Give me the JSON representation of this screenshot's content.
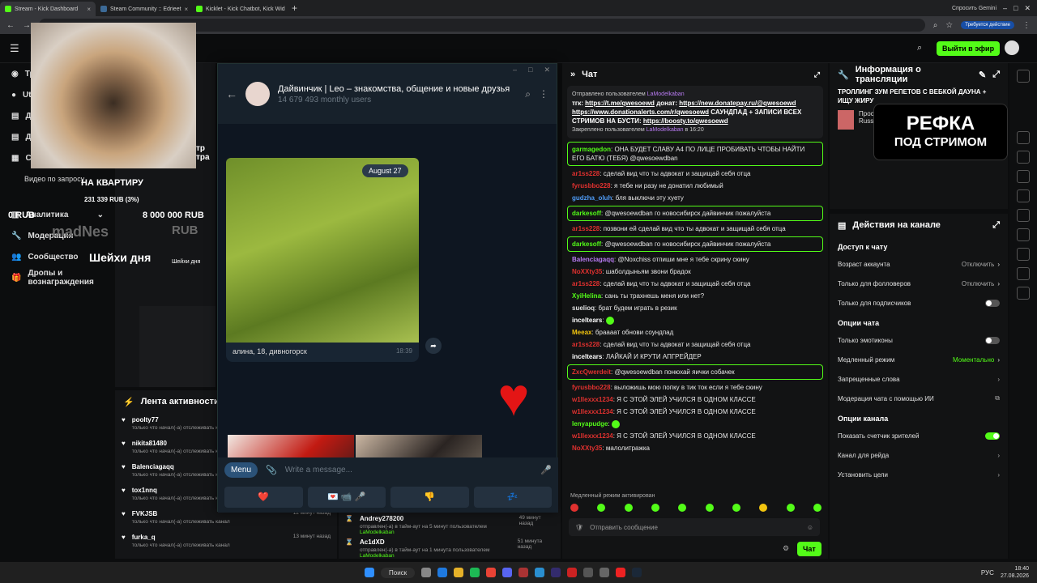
{
  "browser": {
    "tabs": [
      {
        "label": "Stream - Kick Dashboard",
        "color": "#53fc18",
        "active": true
      },
      {
        "label": "Steam Community :: Edrieet",
        "color": "#1b2838",
        "active": false
      },
      {
        "label": "Kicklet - Kick Chatbot, Kick Wid",
        "color": "#53fc18",
        "active": false
      }
    ],
    "gemini_label": "Спросить Gemini",
    "action_label": "Требуется действие"
  },
  "kick": {
    "go_live_label": "Выйти в эфир",
    "left_nav": [
      "Аналитика",
      "Модерация",
      "Сообщество",
      "Дропы и вознаграждения"
    ],
    "nav_top_fragments": [
      "Тр",
      "Ut",
      "Д",
      "Д",
      "Ст"
    ],
    "video_requests": "Видео по запросу",
    "ghost_title": "тр тра"
  },
  "overlays": {
    "apartment_title": "НА КВАРТИРУ",
    "apartment_amount": "231 339 RUB (3%)",
    "goal_left": "0 RUB",
    "goal_right": "8 000 000 RUB",
    "ghost_text": "madNes",
    "ghost_rub": "RUB",
    "neck_day": "Шейхи дня",
    "neck_day_small": "Шейхи дня",
    "refka_line1": "РЕФКА",
    "refka_line2": "ПОД СТРИМОМ"
  },
  "telegram": {
    "title": "Дайвинчик | Leo – знакомства, общение и новые друзья",
    "subtitle": "14 679 493 monthly users",
    "date_badge": "August 27",
    "caption": "алина, 18, дивногорск",
    "time": "18:39",
    "menu_label": "Menu",
    "placeholder": "Write a message...",
    "reactions": [
      "❤️",
      "💌 📹 🎤",
      "👎",
      "💤"
    ]
  },
  "chat": {
    "title": "Чат",
    "pinned_by_label": "Отправлено пользователем",
    "pinned_by_user": "LaModelkaban",
    "pinned_text_parts": [
      "тгк:",
      "https://t.me/qwesoewd",
      "донат:",
      "https://new.donatepay.ru/@qwesoewd",
      "https://www.donationalerts.com/r/qwesoewd",
      "САУНДПАД + ЗАПИСИ ВСЕХ СТРИМОВ НА БУСТИ:",
      "https://boosty.to/qwesoewd"
    ],
    "pinned_footer": "Закреплено пользователем",
    "pinned_footer_user": "LaModelkaban",
    "pinned_footer_time": "в 16:20",
    "messages": [
      {
        "user": "garmagedon",
        "color": "#53fc18",
        "text": "ОНА БУДЕТ СЛАВУ А4 ПО ЛИЦЕ ПРОБИВАТЬ ЧТОБЫ НАЙТИ ЕГО БАТЮ (ТЕБЯ) @qwesoewdban",
        "hl": true
      },
      {
        "user": "ar1ss228",
        "color": "#e0312f",
        "text": "сделай вид что ты адвокат и защищай себя отца",
        "hl": false
      },
      {
        "user": "fyrusbbo228",
        "color": "#e0312f",
        "text": "я тебе ни разу не донатил любимый",
        "hl": false
      },
      {
        "user": "gudzha_oluh",
        "color": "#4f9cf7",
        "text": "бля выключи эту хуету",
        "hl": false
      },
      {
        "user": "darkesoff",
        "color": "#53fc18",
        "text": "@qwesoewdban го новосибирск дайвинчик пожалуйста",
        "hl": true
      },
      {
        "user": "ar1ss228",
        "color": "#e0312f",
        "text": "позвони ей сделай вид что ты адвокат и защищай себя отца",
        "hl": false
      },
      {
        "user": "darkesoff",
        "color": "#53fc18",
        "text": "@qwesoewdban го новосибирск дайвинчик пожалуйста",
        "hl": true
      },
      {
        "user": "Balenciagaqq",
        "color": "#b87bf2",
        "text": "@Noxchiss отпиши мне я тебе скрину скину",
        "hl": false
      },
      {
        "user": "NoXXty35",
        "color": "#e0312f",
        "text": "шаболдыньям звони брадок",
        "hl": false
      },
      {
        "user": "ar1ss228",
        "color": "#e0312f",
        "text": "сделай вид что ты адвокат и защищай себя отца",
        "hl": false
      },
      {
        "user": "XyiHelina",
        "color": "#53fc18",
        "text": "сань ты трахнешь меня или нет?",
        "hl": false
      },
      {
        "user": "suelioq",
        "color": "#e0e0e0",
        "text": "брат будем играть в резик",
        "hl": false
      },
      {
        "user": "inceltears",
        "color": "#ffffff",
        "text": "",
        "hl": false
      },
      {
        "user": "Meeax",
        "color": "#f1c40f",
        "text": "браааат обнови соундпад",
        "hl": false
      },
      {
        "user": "ar1ss228",
        "color": "#e0312f",
        "text": "сделай вид что ты адвокат и защищай себя отца",
        "hl": false
      },
      {
        "user": "inceltears",
        "color": "#ffffff",
        "text": "ЛАЙКАЙ И КРУТИ АПГРЕЙДЕР",
        "hl": false
      },
      {
        "user": "ZxcQwerdeit",
        "color": "#e0312f",
        "text": "@qwesoewdban понюхай яички собачек",
        "hl": true
      },
      {
        "user": "fyrusbbo228",
        "color": "#e0312f",
        "text": "выложишь мою попку в тик ток если я тебе скину",
        "hl": false
      },
      {
        "user": "w1llexxx1234",
        "color": "#e0312f",
        "text": "Я С ЭТОЙ ЭЛЕЙ УЧИЛСЯ В ОДНОМ КЛАССЕ",
        "hl": false
      },
      {
        "user": "w1llexxx1234",
        "color": "#e0312f",
        "text": "Я С ЭТОЙ ЭЛЕЙ УЧИЛСЯ В ОДНОМ КЛАССЕ",
        "hl": false
      },
      {
        "user": "lenyapudge",
        "color": "#53fc18",
        "text": "",
        "hl": false
      },
      {
        "user": "w1llexxx1234",
        "color": "#e0312f",
        "text": "Я С ЭТОЙ ЭЛЕЙ УЧИЛСЯ В ОДНОМ КЛАССЕ",
        "hl": false
      },
      {
        "user": "NoXXty35",
        "color": "#e0312f",
        "text": "малолитражка",
        "hl": false
      }
    ],
    "slow_mode_notice": "Медленный режим активирован",
    "input_placeholder": "Отправить сообщение",
    "send_label": "Чат"
  },
  "stream_info": {
    "title": "Информация о трансляции",
    "stream_title": "ТРОЛЛИНГ ЗУМ РЕПЕТОВ С ВЕБКОЙ ДАУНА + ИЩУ ЖИРУ",
    "category_fragment": "Прост",
    "lang_fragment": "Russ"
  },
  "actions": {
    "title": "Действия на канале",
    "chat_access": "Доступ к чату",
    "age_label": "Возраст аккаунта",
    "age_value": "Отключить",
    "followers_label": "Только для фолловеров",
    "followers_value": "Отключить",
    "subs_label": "Только для подписчиков",
    "chat_options": "Опции чата",
    "emotes_label": "Только эмотиконы",
    "slow_label": "Медленный режим",
    "slow_value": "Моментально",
    "banned_words": "Запрещенные слова",
    "ai_mod": "Модерация чата с помощью ИИ",
    "channel_options": "Опции канала",
    "viewer_count": "Показать счетчик зрителей",
    "raid_channel": "Канал для рейда",
    "set_goals": "Установить цели"
  },
  "activity": {
    "title": "Лента активности",
    "items": [
      {
        "name": "poolty77",
        "sub": "только что начал(-а) отслеживать канал",
        "time": ""
      },
      {
        "name": "nikita81480",
        "sub": "только что начал(-а) отслеживать канал",
        "time": ""
      },
      {
        "name": "Balenciagaqq",
        "sub": "только что начал(-а) отслеживать канал",
        "time": ""
      },
      {
        "name": "tox1nnq",
        "sub": "только что начал(-а) отслеживать канал",
        "time": ""
      },
      {
        "name": "FVKJSB",
        "sub": "только что начал(-а) отслеживать канал",
        "time": "12 минут назад"
      },
      {
        "name": "furka_q",
        "sub": "только что начал(-а) отслеживать канал",
        "time": "13 минут назад"
      }
    ],
    "items2": [
      {
        "name": "Andrey278200",
        "sub": "отправлен(-а) в тайм-аут на 5 минут пользователем",
        "by": "LaModelkaban",
        "time": "49 минут назад"
      },
      {
        "name": "Ac1dXD",
        "sub": "отправлен(-а) в тайм-аут на 1 минута пользователем",
        "by": "LaModelkaban",
        "time": "51 минута назад"
      }
    ]
  },
  "taskbar": {
    "search_label": "Поиск",
    "lang": "РУС",
    "time": "18:40",
    "date": "27.08.2026"
  },
  "colors": {
    "kick_green": "#53fc18",
    "danger": "#e0312f"
  }
}
